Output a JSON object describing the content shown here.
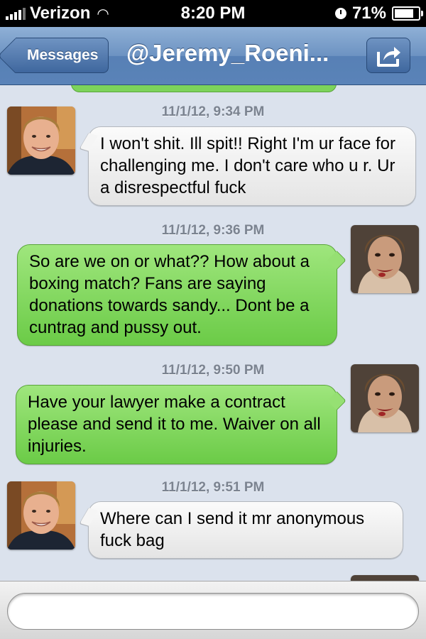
{
  "status_bar": {
    "carrier": "Verizon",
    "time": "8:20 PM",
    "battery": "71%",
    "battery_level": 0.71,
    "icons": [
      "signal-icon",
      "wifi-icon",
      "alarm-icon",
      "battery-icon"
    ]
  },
  "nav": {
    "back_label": "Messages",
    "title": "@Jeremy_Roeni...",
    "share_icon": "share-icon"
  },
  "colors": {
    "nav_bar": "#6d93c2",
    "outgoing_bubble": "#7cd35b",
    "incoming_bubble": "#f0f0f0",
    "background": "#dbe2ed"
  },
  "messages": [
    {
      "timestamp": "11/1/12, 9:34 PM",
      "direction": "incoming",
      "text": "I won't shit. Ill spit!! Right I'm ur face for challenging me. I don't care who u r. Ur a disrespectful fuck"
    },
    {
      "timestamp": "11/1/12, 9:36 PM",
      "direction": "outgoing",
      "text": "So are we on or what?? How about a boxing match? Fans are saying donations towards sandy... Dont be a cuntrag and pussy out."
    },
    {
      "timestamp": "11/1/12, 9:50 PM",
      "direction": "outgoing",
      "text": "Have your lawyer make a contract please and send it to me. Waiver on all injuries."
    },
    {
      "timestamp": "11/1/12, 9:51 PM",
      "direction": "incoming",
      "text": "Where can I send it mr anonymous fuck bag"
    }
  ],
  "input": {
    "value": "",
    "placeholder": ""
  }
}
